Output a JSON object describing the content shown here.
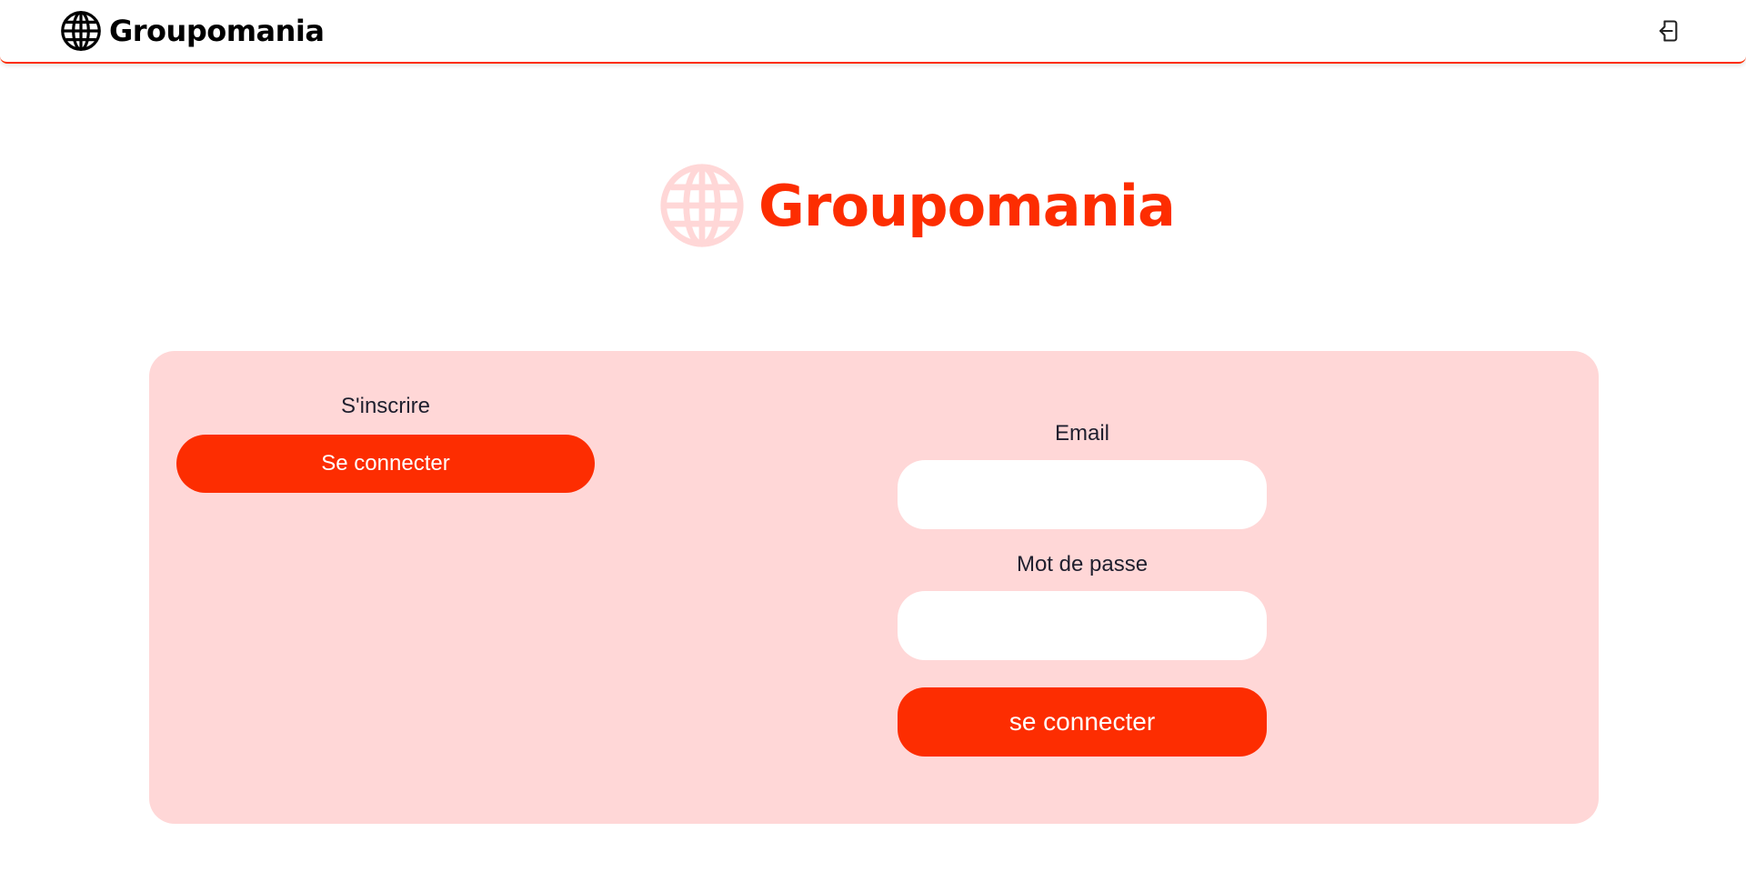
{
  "header": {
    "brand": "Groupomania",
    "logo_icon": "globe-icon",
    "logout_icon": "logout-icon"
  },
  "hero": {
    "brand": "Groupomania",
    "logo_icon": "globe-icon"
  },
  "signup": {
    "label": "S'inscrire",
    "switch_button": "Se connecter"
  },
  "login": {
    "email_label": "Email",
    "email_value": "",
    "password_label": "Mot de passe",
    "password_value": "",
    "submit_button": "se connecter"
  },
  "colors": {
    "accent": "#FD2D01",
    "card_background": "#FFD7D7",
    "hero_globe": "#FFD7D7",
    "text": "#1f1f2e"
  }
}
